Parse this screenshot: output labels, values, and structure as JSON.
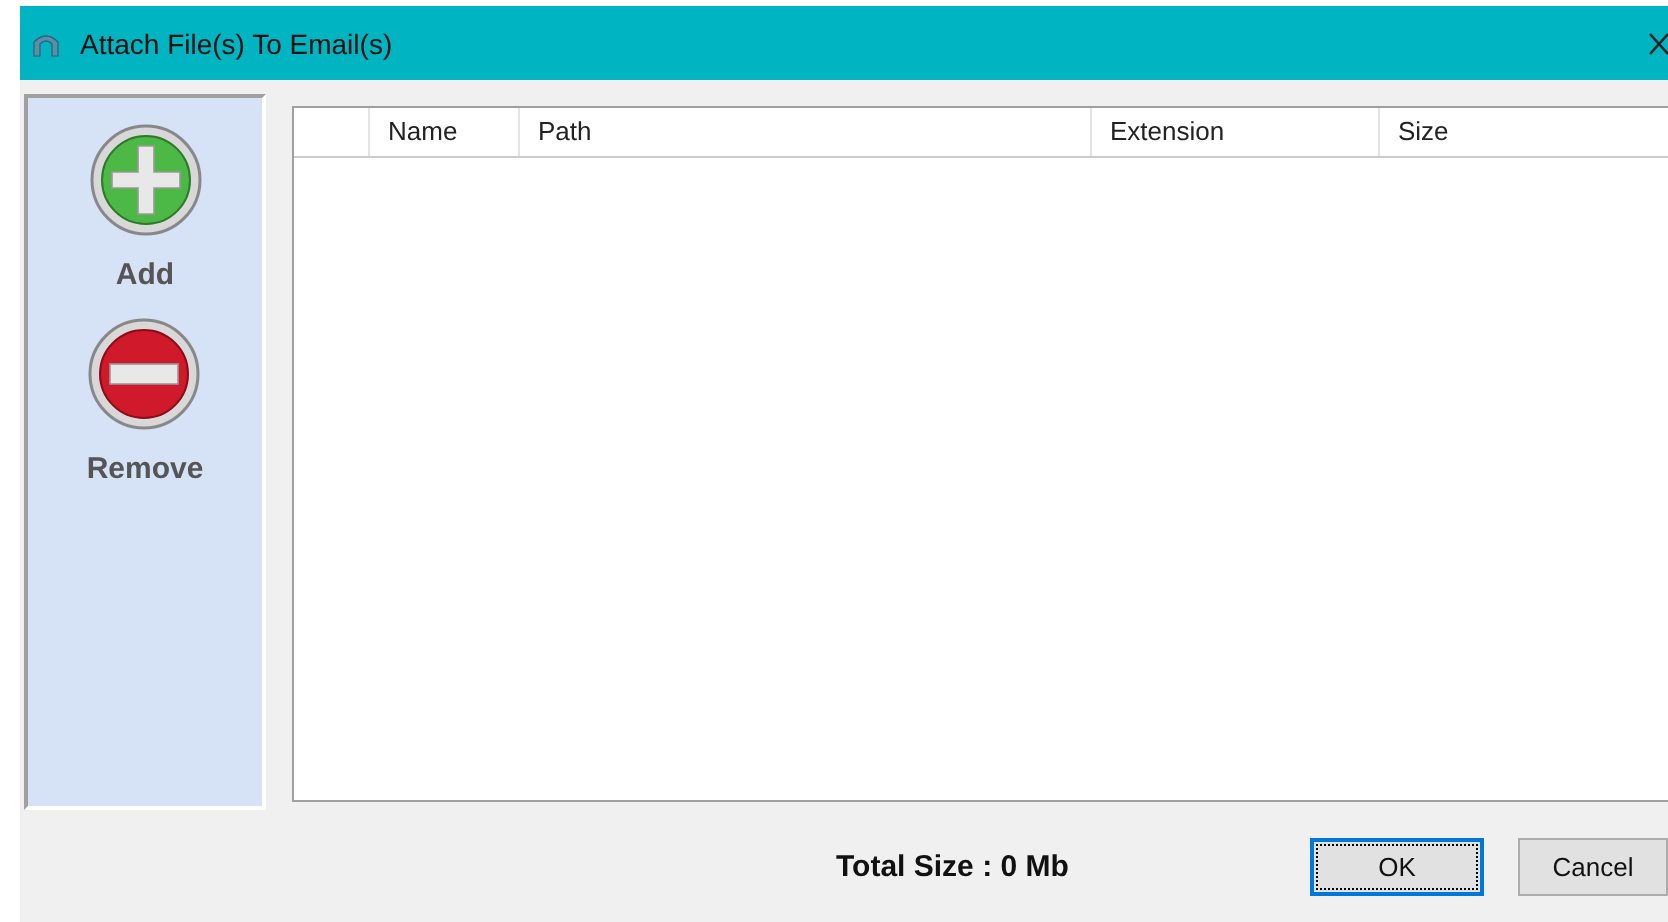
{
  "window": {
    "title": "Attach File(s) To Email(s)"
  },
  "sidebar": {
    "items": [
      {
        "kind": "add",
        "label": "Add"
      },
      {
        "kind": "remove",
        "label": "Remove"
      }
    ]
  },
  "table": {
    "columns": [
      "Name",
      "Path",
      "Extension",
      "Size"
    ]
  },
  "footer": {
    "total_size": "Total Size : 0 Mb",
    "buttons": [
      {
        "label": "OK",
        "selected": true
      },
      {
        "label": "Cancel",
        "selected": false
      }
    ]
  }
}
